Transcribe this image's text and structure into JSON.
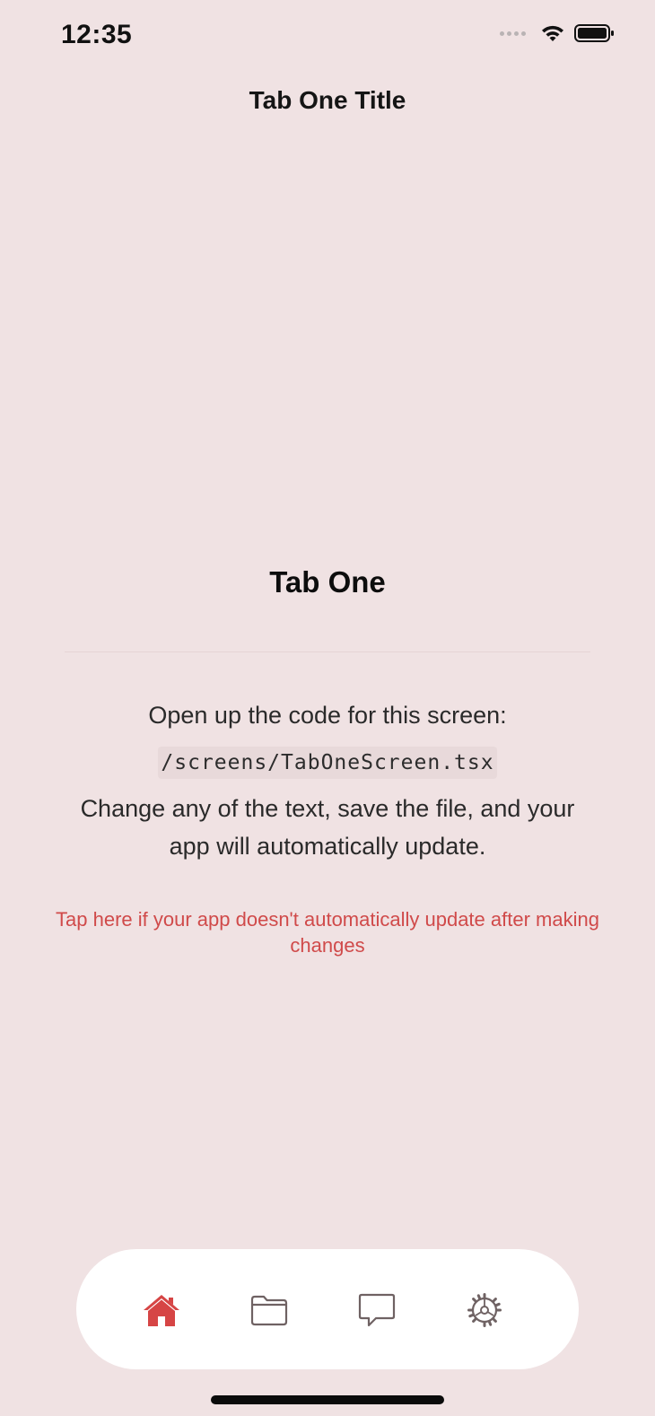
{
  "status_bar": {
    "time": "12:35"
  },
  "header": {
    "title": "Tab One Title"
  },
  "main": {
    "title": "Tab One",
    "intro": "Open up the code for this screen:",
    "file_path": "/screens/TabOneScreen.tsx",
    "description": "Change any of the text, save the file, and your app will automatically update.",
    "help_link": "Tap here if your app doesn't automatically update after making changes"
  },
  "tab_bar": {
    "items": [
      {
        "icon": "home-icon",
        "active": true
      },
      {
        "icon": "folder-icon",
        "active": false
      },
      {
        "icon": "chat-icon",
        "active": false
      },
      {
        "icon": "gear-icon",
        "active": false
      }
    ]
  },
  "colors": {
    "background": "#f0e2e3",
    "accent": "#d64545",
    "inactive_icon": "#6f6263",
    "link": "#d04a4a"
  }
}
